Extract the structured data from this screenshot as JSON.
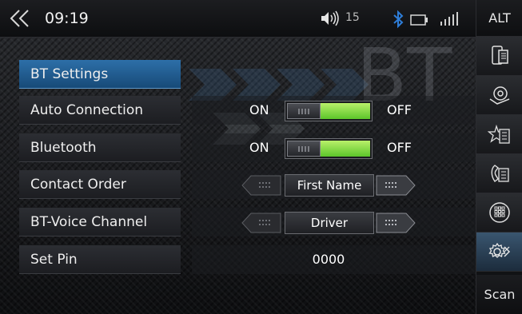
{
  "status": {
    "time": "09:19",
    "volume": "15",
    "icons": [
      "back-icon",
      "speaker-icon",
      "bluetooth-icon",
      "battery-icon",
      "signal-icon"
    ]
  },
  "side": {
    "alt_label": "ALT",
    "scan_label": "Scan",
    "icons": [
      "phone-icon",
      "music-bt-icon",
      "favorites-icon",
      "call-log-icon",
      "keypad-icon",
      "settings-icon"
    ]
  },
  "watermark": "BT",
  "settings": {
    "title": "BT Settings",
    "auto_connection": {
      "label": "Auto Connection",
      "on": "ON",
      "off": "OFF",
      "state": "on"
    },
    "bluetooth": {
      "label": "Bluetooth",
      "on": "ON",
      "off": "OFF",
      "state": "on"
    },
    "contact_order": {
      "label": "Contact Order",
      "value": "First Name"
    },
    "voice_channel": {
      "label": "BT-Voice Channel",
      "value": "Driver"
    },
    "set_pin": {
      "label": "Set Pin",
      "value": "0000"
    }
  },
  "colors": {
    "accent": "#2d6fa8",
    "toggle_on": "#7ddc3c",
    "bluetooth": "#2e7dd8"
  }
}
